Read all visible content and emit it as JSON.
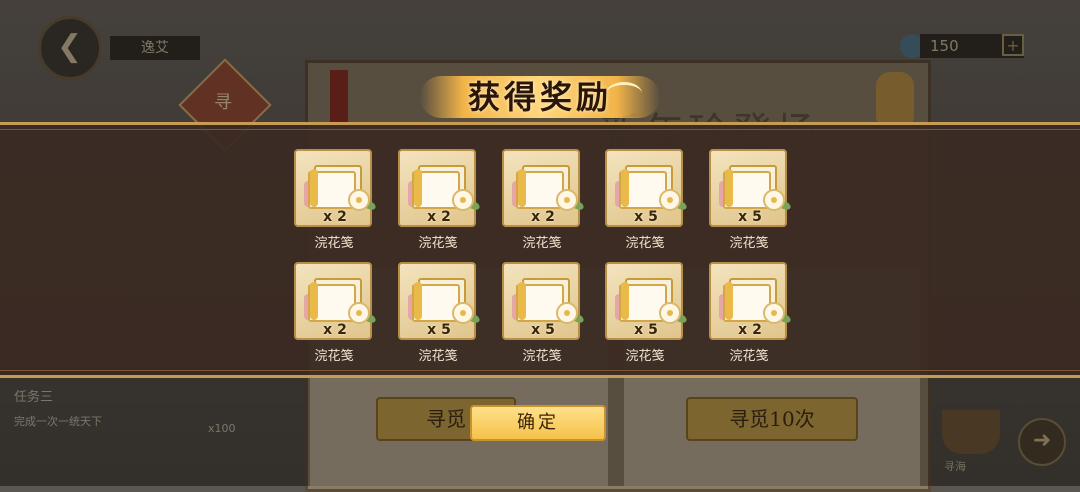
{
  "background": {
    "player_name": "逸艾",
    "currency_amount": "150",
    "currency_plus": "+",
    "side_tag": "寻",
    "banner_title": "新年珍登场",
    "quest_title": "任务三",
    "quest_desc": "完成一次一统天下",
    "quest_reward_count": "x100",
    "seek_once_label": "寻觅",
    "seek_ten_label": "寻觅10次",
    "ship_label": "寻海",
    "back_icon": "chevron-left-icon",
    "next_icon": "arrow-right-icon"
  },
  "popup": {
    "title": "获得奖励",
    "confirm_label": "确定",
    "items": [
      {
        "name": "浣花笺",
        "qty": "x 2",
        "icon": "letter-paper-icon"
      },
      {
        "name": "浣花笺",
        "qty": "x 2",
        "icon": "letter-paper-icon"
      },
      {
        "name": "浣花笺",
        "qty": "x 2",
        "icon": "letter-paper-icon"
      },
      {
        "name": "浣花笺",
        "qty": "x 5",
        "icon": "letter-paper-icon"
      },
      {
        "name": "浣花笺",
        "qty": "x 5",
        "icon": "letter-paper-icon"
      },
      {
        "name": "浣花笺",
        "qty": "x 2",
        "icon": "letter-paper-icon"
      },
      {
        "name": "浣花笺",
        "qty": "x 5",
        "icon": "letter-paper-icon"
      },
      {
        "name": "浣花笺",
        "qty": "x 5",
        "icon": "letter-paper-icon"
      },
      {
        "name": "浣花笺",
        "qty": "x 5",
        "icon": "letter-paper-icon"
      },
      {
        "name": "浣花笺",
        "qty": "x 2",
        "icon": "letter-paper-icon"
      }
    ]
  },
  "colors": {
    "band_bg": "#3a2a22",
    "band_border": "#c79b52",
    "button_gold": "#f5c24a",
    "item_text": "#f1e6cf"
  }
}
